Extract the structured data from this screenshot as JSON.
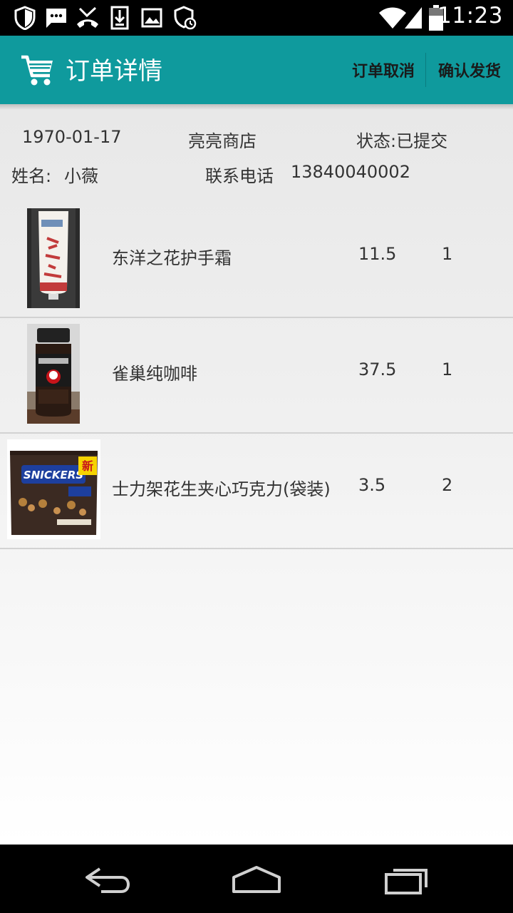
{
  "status_bar": {
    "time": "11:23",
    "left_icons": [
      "shield-icon",
      "message-icon",
      "missed-call-icon",
      "download-icon",
      "image-icon",
      "security-sync-icon"
    ],
    "right_icons": [
      "wifi-icon",
      "signal-icon",
      "battery-icon"
    ]
  },
  "action_bar": {
    "title": "订单详情",
    "cancel_label": "订单取消",
    "confirm_label": "确认发货",
    "color": "#0f9a9d"
  },
  "order": {
    "date": "1970-01-17",
    "store": "亮亮商店",
    "status": "状态:已提交",
    "name_label": "姓名:",
    "name": "小薇",
    "phone_label": "联系电话",
    "phone": "13840040002"
  },
  "items": [
    {
      "name": "东洋之花护手霜",
      "price": "11.5",
      "qty": "1",
      "image": "hand-cream-tube"
    },
    {
      "name": "雀巢纯咖啡",
      "price": "37.5",
      "qty": "1",
      "image": "coffee-jar"
    },
    {
      "name": "士力架花生夹心巧克力(袋装)",
      "price": "3.5",
      "qty": "2",
      "image": "chocolate-bag",
      "brand_text": "SNICKERS",
      "badge_text": "新"
    }
  ],
  "nav_bar": {
    "buttons": [
      "back-icon",
      "home-icon",
      "recents-icon"
    ]
  }
}
